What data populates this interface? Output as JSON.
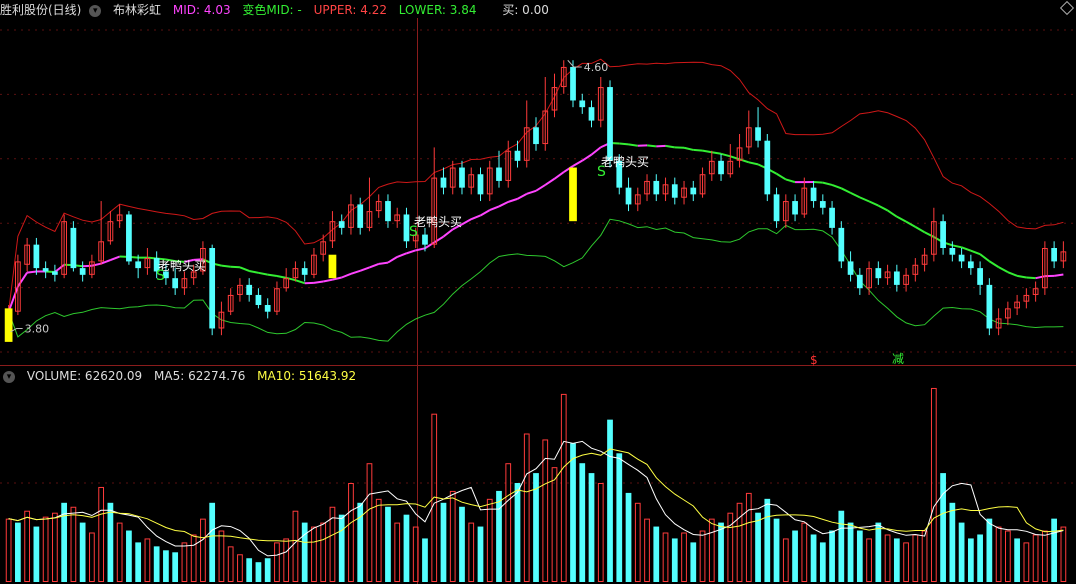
{
  "price_header": {
    "stock": "胜利股份(日线)",
    "indicator": "布林彩虹",
    "mid": "MID: 4.03",
    "color_mid": "变色MID: -",
    "upper": "UPPER: 4.22",
    "lower": "LOWER: 3.84",
    "buy": "买: 0.00"
  },
  "volume_header": {
    "volume": "VOLUME: 62620.09",
    "ma5": "MA5: 62274.76",
    "ma10": "MA10: 51643.92"
  },
  "annotations": {
    "high_label": "4.60",
    "low_label": "3.80",
    "buy_text": "老鸭头买",
    "s_mark": "S",
    "red_mark": "$",
    "reduce_mark": "减"
  },
  "colors": {
    "up": "#ff3b3b",
    "down": "#54ffff",
    "upper_band": "#d01818",
    "lower_band": "#2ec82e",
    "mid_rising": "#ff44ff",
    "mid_falling": "#33ee33",
    "signal_bar": "#ffff00",
    "vol_ma5": "#ffffff",
    "vol_ma10": "#ffff44"
  },
  "chart_data": {
    "type": "candlestick",
    "price_range": [
      3.7,
      4.72
    ],
    "candles": [
      {
        "o": 3.8,
        "c": 3.85,
        "h": 3.87,
        "l": 3.79
      },
      {
        "o": 3.85,
        "c": 4.0,
        "h": 4.02,
        "l": 3.84
      },
      {
        "o": 3.99,
        "c": 4.05,
        "h": 4.07,
        "l": 3.97
      },
      {
        "o": 4.05,
        "c": 3.98,
        "h": 4.07,
        "l": 3.96
      },
      {
        "o": 3.98,
        "c": 3.97,
        "h": 4.0,
        "l": 3.95
      },
      {
        "o": 3.97,
        "c": 3.96,
        "h": 3.99,
        "l": 3.94
      },
      {
        "o": 3.96,
        "c": 4.12,
        "h": 4.14,
        "l": 3.95
      },
      {
        "o": 4.1,
        "c": 3.98,
        "h": 4.12,
        "l": 3.97
      },
      {
        "o": 3.98,
        "c": 3.96,
        "h": 4.0,
        "l": 3.94
      },
      {
        "o": 3.96,
        "c": 4.0,
        "h": 4.02,
        "l": 3.95
      },
      {
        "o": 4.0,
        "c": 4.06,
        "h": 4.18,
        "l": 3.99
      },
      {
        "o": 4.06,
        "c": 4.12,
        "h": 4.15,
        "l": 4.05
      },
      {
        "o": 4.12,
        "c": 4.14,
        "h": 4.17,
        "l": 4.1
      },
      {
        "o": 4.14,
        "c": 4.0,
        "h": 4.15,
        "l": 3.99
      },
      {
        "o": 4.0,
        "c": 3.98,
        "h": 4.02,
        "l": 3.95
      },
      {
        "o": 3.98,
        "c": 4.01,
        "h": 4.04,
        "l": 3.96
      },
      {
        "o": 4.01,
        "c": 3.97,
        "h": 4.03,
        "l": 3.95
      },
      {
        "o": 3.97,
        "c": 3.95,
        "h": 3.99,
        "l": 3.93
      },
      {
        "o": 3.95,
        "c": 3.92,
        "h": 3.98,
        "l": 3.9
      },
      {
        "o": 3.92,
        "c": 3.95,
        "h": 3.97,
        "l": 3.9
      },
      {
        "o": 3.95,
        "c": 3.97,
        "h": 3.99,
        "l": 3.93
      },
      {
        "o": 3.97,
        "c": 4.04,
        "h": 4.06,
        "l": 3.96
      },
      {
        "o": 4.04,
        "c": 3.8,
        "h": 4.05,
        "l": 3.78
      },
      {
        "o": 3.8,
        "c": 3.85,
        "h": 3.88,
        "l": 3.78
      },
      {
        "o": 3.85,
        "c": 3.9,
        "h": 3.92,
        "l": 3.84
      },
      {
        "o": 3.9,
        "c": 3.93,
        "h": 3.95,
        "l": 3.88
      },
      {
        "o": 3.93,
        "c": 3.9,
        "h": 3.95,
        "l": 3.88
      },
      {
        "o": 3.9,
        "c": 3.87,
        "h": 3.92,
        "l": 3.86
      },
      {
        "o": 3.87,
        "c": 3.85,
        "h": 3.89,
        "l": 3.83
      },
      {
        "o": 3.85,
        "c": 3.92,
        "h": 3.94,
        "l": 3.84
      },
      {
        "o": 3.92,
        "c": 3.95,
        "h": 3.98,
        "l": 3.91
      },
      {
        "o": 3.95,
        "c": 3.98,
        "h": 4.0,
        "l": 3.94
      },
      {
        "o": 3.98,
        "c": 3.96,
        "h": 4.0,
        "l": 3.94
      },
      {
        "o": 3.96,
        "c": 4.02,
        "h": 4.04,
        "l": 3.95
      },
      {
        "o": 4.02,
        "c": 4.06,
        "h": 4.08,
        "l": 4.0
      },
      {
        "o": 4.06,
        "c": 4.12,
        "h": 4.15,
        "l": 4.04
      },
      {
        "o": 4.12,
        "c": 4.1,
        "h": 4.14,
        "l": 4.08
      },
      {
        "o": 4.1,
        "c": 4.17,
        "h": 4.2,
        "l": 4.08
      },
      {
        "o": 4.17,
        "c": 4.1,
        "h": 4.19,
        "l": 4.08
      },
      {
        "o": 4.1,
        "c": 4.15,
        "h": 4.25,
        "l": 4.09
      },
      {
        "o": 4.15,
        "c": 4.18,
        "h": 4.2,
        "l": 4.13
      },
      {
        "o": 4.18,
        "c": 4.12,
        "h": 4.2,
        "l": 4.1
      },
      {
        "o": 4.12,
        "c": 4.14,
        "h": 4.16,
        "l": 4.1
      },
      {
        "o": 4.14,
        "c": 4.06,
        "h": 4.16,
        "l": 4.04
      },
      {
        "o": 4.06,
        "c": 4.08,
        "h": 4.1,
        "l": 4.04
      },
      {
        "o": 4.08,
        "c": 4.05,
        "h": 4.1,
        "l": 4.03
      },
      {
        "o": 4.05,
        "c": 4.25,
        "h": 4.34,
        "l": 4.04
      },
      {
        "o": 4.25,
        "c": 4.22,
        "h": 4.28,
        "l": 4.2
      },
      {
        "o": 4.22,
        "c": 4.28,
        "h": 4.3,
        "l": 4.2
      },
      {
        "o": 4.28,
        "c": 4.22,
        "h": 4.3,
        "l": 4.2
      },
      {
        "o": 4.22,
        "c": 4.26,
        "h": 4.28,
        "l": 4.2
      },
      {
        "o": 4.26,
        "c": 4.2,
        "h": 4.28,
        "l": 4.18
      },
      {
        "o": 4.2,
        "c": 4.28,
        "h": 4.3,
        "l": 4.18
      },
      {
        "o": 4.28,
        "c": 4.24,
        "h": 4.33,
        "l": 4.22
      },
      {
        "o": 4.24,
        "c": 4.33,
        "h": 4.36,
        "l": 4.22
      },
      {
        "o": 4.33,
        "c": 4.3,
        "h": 4.36,
        "l": 4.28
      },
      {
        "o": 4.3,
        "c": 4.4,
        "h": 4.48,
        "l": 4.28
      },
      {
        "o": 4.4,
        "c": 4.35,
        "h": 4.43,
        "l": 4.33
      },
      {
        "o": 4.35,
        "c": 4.45,
        "h": 4.55,
        "l": 4.33
      },
      {
        "o": 4.45,
        "c": 4.52,
        "h": 4.56,
        "l": 4.43
      },
      {
        "o": 4.52,
        "c": 4.58,
        "h": 4.6,
        "l": 4.5
      },
      {
        "o": 4.58,
        "c": 4.48,
        "h": 4.6,
        "l": 4.46
      },
      {
        "o": 4.48,
        "c": 4.46,
        "h": 4.5,
        "l": 4.44
      },
      {
        "o": 4.46,
        "c": 4.42,
        "h": 4.48,
        "l": 4.4
      },
      {
        "o": 4.42,
        "c": 4.52,
        "h": 4.55,
        "l": 4.4
      },
      {
        "o": 4.52,
        "c": 4.3,
        "h": 4.54,
        "l": 4.28
      },
      {
        "o": 4.3,
        "c": 4.22,
        "h": 4.32,
        "l": 4.2
      },
      {
        "o": 4.22,
        "c": 4.17,
        "h": 4.25,
        "l": 4.15
      },
      {
        "o": 4.17,
        "c": 4.2,
        "h": 4.22,
        "l": 4.15
      },
      {
        "o": 4.2,
        "c": 4.24,
        "h": 4.26,
        "l": 4.18
      },
      {
        "o": 4.24,
        "c": 4.2,
        "h": 4.26,
        "l": 4.18
      },
      {
        "o": 4.2,
        "c": 4.23,
        "h": 4.25,
        "l": 4.18
      },
      {
        "o": 4.23,
        "c": 4.19,
        "h": 4.25,
        "l": 4.17
      },
      {
        "o": 4.19,
        "c": 4.22,
        "h": 4.24,
        "l": 4.17
      },
      {
        "o": 4.22,
        "c": 4.2,
        "h": 4.24,
        "l": 4.18
      },
      {
        "o": 4.2,
        "c": 4.26,
        "h": 4.28,
        "l": 4.19
      },
      {
        "o": 4.26,
        "c": 4.3,
        "h": 4.33,
        "l": 4.24
      },
      {
        "o": 4.3,
        "c": 4.26,
        "h": 4.32,
        "l": 4.24
      },
      {
        "o": 4.26,
        "c": 4.3,
        "h": 4.35,
        "l": 4.25
      },
      {
        "o": 4.3,
        "c": 4.34,
        "h": 4.38,
        "l": 4.28
      },
      {
        "o": 4.34,
        "c": 4.4,
        "h": 4.45,
        "l": 4.32
      },
      {
        "o": 4.4,
        "c": 4.36,
        "h": 4.46,
        "l": 4.34
      },
      {
        "o": 4.36,
        "c": 4.2,
        "h": 4.38,
        "l": 4.18
      },
      {
        "o": 4.2,
        "c": 4.12,
        "h": 4.22,
        "l": 4.1
      },
      {
        "o": 4.12,
        "c": 4.18,
        "h": 4.2,
        "l": 4.1
      },
      {
        "o": 4.18,
        "c": 4.14,
        "h": 4.2,
        "l": 4.12
      },
      {
        "o": 4.14,
        "c": 4.22,
        "h": 4.25,
        "l": 4.13
      },
      {
        "o": 4.22,
        "c": 4.18,
        "h": 4.24,
        "l": 4.16
      },
      {
        "o": 4.18,
        "c": 4.16,
        "h": 4.2,
        "l": 4.14
      },
      {
        "o": 4.16,
        "c": 4.1,
        "h": 4.18,
        "l": 4.08
      },
      {
        "o": 4.1,
        "c": 4.0,
        "h": 4.12,
        "l": 3.98
      },
      {
        "o": 4.0,
        "c": 3.96,
        "h": 4.03,
        "l": 3.94
      },
      {
        "o": 3.96,
        "c": 3.92,
        "h": 3.98,
        "l": 3.9
      },
      {
        "o": 3.92,
        "c": 3.98,
        "h": 4.0,
        "l": 3.9
      },
      {
        "o": 3.98,
        "c": 3.95,
        "h": 4.0,
        "l": 3.93
      },
      {
        "o": 3.95,
        "c": 3.97,
        "h": 3.99,
        "l": 3.93
      },
      {
        "o": 3.97,
        "c": 3.93,
        "h": 3.99,
        "l": 3.91
      },
      {
        "o": 3.93,
        "c": 3.96,
        "h": 3.98,
        "l": 3.91
      },
      {
        "o": 3.96,
        "c": 3.99,
        "h": 4.01,
        "l": 3.94
      },
      {
        "o": 3.99,
        "c": 4.02,
        "h": 4.04,
        "l": 3.97
      },
      {
        "o": 4.02,
        "c": 4.12,
        "h": 4.16,
        "l": 4.0
      },
      {
        "o": 4.12,
        "c": 4.04,
        "h": 4.14,
        "l": 4.02
      },
      {
        "o": 4.04,
        "c": 4.02,
        "h": 4.06,
        "l": 4.0
      },
      {
        "o": 4.02,
        "c": 4.0,
        "h": 4.04,
        "l": 3.98
      },
      {
        "o": 4.0,
        "c": 3.98,
        "h": 4.02,
        "l": 3.96
      },
      {
        "o": 3.98,
        "c": 3.93,
        "h": 4.0,
        "l": 3.9
      },
      {
        "o": 3.93,
        "c": 3.8,
        "h": 3.95,
        "l": 3.78
      },
      {
        "o": 3.8,
        "c": 3.83,
        "h": 3.86,
        "l": 3.78
      },
      {
        "o": 3.83,
        "c": 3.86,
        "h": 3.88,
        "l": 3.81
      },
      {
        "o": 3.86,
        "c": 3.88,
        "h": 3.9,
        "l": 3.84
      },
      {
        "o": 3.88,
        "c": 3.9,
        "h": 3.92,
        "l": 3.86
      },
      {
        "o": 3.9,
        "c": 3.92,
        "h": 3.94,
        "l": 3.88
      },
      {
        "o": 3.92,
        "c": 4.04,
        "h": 4.06,
        "l": 3.9
      },
      {
        "o": 4.04,
        "c": 4.0,
        "h": 4.06,
        "l": 3.98
      },
      {
        "o": 4.0,
        "c": 4.03,
        "h": 4.06,
        "l": 3.98
      }
    ],
    "volume_range": [
      0,
      100
    ],
    "volumes": [
      {
        "v": 32,
        "up": true
      },
      {
        "v": 30,
        "up": false
      },
      {
        "v": 36,
        "up": true
      },
      {
        "v": 28,
        "up": false
      },
      {
        "v": 33,
        "up": true
      },
      {
        "v": 35,
        "up": true
      },
      {
        "v": 40,
        "up": false
      },
      {
        "v": 38,
        "up": true
      },
      {
        "v": 30,
        "up": false
      },
      {
        "v": 25,
        "up": true
      },
      {
        "v": 48,
        "up": true
      },
      {
        "v": 40,
        "up": false
      },
      {
        "v": 30,
        "up": true
      },
      {
        "v": 26,
        "up": false
      },
      {
        "v": 20,
        "up": false
      },
      {
        "v": 22,
        "up": true
      },
      {
        "v": 18,
        "up": false
      },
      {
        "v": 16,
        "up": false
      },
      {
        "v": 15,
        "up": false
      },
      {
        "v": 20,
        "up": true
      },
      {
        "v": 24,
        "up": true
      },
      {
        "v": 32,
        "up": true
      },
      {
        "v": 40,
        "up": false
      },
      {
        "v": 26,
        "up": true
      },
      {
        "v": 18,
        "up": true
      },
      {
        "v": 14,
        "up": true
      },
      {
        "v": 12,
        "up": false
      },
      {
        "v": 10,
        "up": false
      },
      {
        "v": 12,
        "up": false
      },
      {
        "v": 20,
        "up": true
      },
      {
        "v": 22,
        "up": true
      },
      {
        "v": 36,
        "up": true
      },
      {
        "v": 30,
        "up": false
      },
      {
        "v": 28,
        "up": true
      },
      {
        "v": 30,
        "up": true
      },
      {
        "v": 38,
        "up": true
      },
      {
        "v": 34,
        "up": false
      },
      {
        "v": 50,
        "up": true
      },
      {
        "v": 40,
        "up": false
      },
      {
        "v": 60,
        "up": true
      },
      {
        "v": 42,
        "up": true
      },
      {
        "v": 38,
        "up": false
      },
      {
        "v": 30,
        "up": true
      },
      {
        "v": 34,
        "up": false
      },
      {
        "v": 28,
        "up": true
      },
      {
        "v": 22,
        "up": false
      },
      {
        "v": 85,
        "up": true
      },
      {
        "v": 40,
        "up": false
      },
      {
        "v": 46,
        "up": true
      },
      {
        "v": 38,
        "up": false
      },
      {
        "v": 30,
        "up": true
      },
      {
        "v": 28,
        "up": false
      },
      {
        "v": 42,
        "up": true
      },
      {
        "v": 46,
        "up": false
      },
      {
        "v": 60,
        "up": true
      },
      {
        "v": 50,
        "up": false
      },
      {
        "v": 75,
        "up": true
      },
      {
        "v": 55,
        "up": false
      },
      {
        "v": 72,
        "up": true
      },
      {
        "v": 58,
        "up": true
      },
      {
        "v": 95,
        "up": true
      },
      {
        "v": 70,
        "up": false
      },
      {
        "v": 60,
        "up": false
      },
      {
        "v": 55,
        "up": false
      },
      {
        "v": 50,
        "up": true
      },
      {
        "v": 82,
        "up": false
      },
      {
        "v": 65,
        "up": false
      },
      {
        "v": 45,
        "up": false
      },
      {
        "v": 40,
        "up": true
      },
      {
        "v": 32,
        "up": true
      },
      {
        "v": 28,
        "up": false
      },
      {
        "v": 25,
        "up": true
      },
      {
        "v": 22,
        "up": false
      },
      {
        "v": 25,
        "up": true
      },
      {
        "v": 20,
        "up": false
      },
      {
        "v": 26,
        "up": true
      },
      {
        "v": 32,
        "up": true
      },
      {
        "v": 30,
        "up": false
      },
      {
        "v": 35,
        "up": true
      },
      {
        "v": 40,
        "up": true
      },
      {
        "v": 45,
        "up": true
      },
      {
        "v": 35,
        "up": false
      },
      {
        "v": 42,
        "up": false
      },
      {
        "v": 32,
        "up": false
      },
      {
        "v": 22,
        "up": true
      },
      {
        "v": 26,
        "up": false
      },
      {
        "v": 30,
        "up": true
      },
      {
        "v": 24,
        "up": false
      },
      {
        "v": 20,
        "up": false
      },
      {
        "v": 26,
        "up": false
      },
      {
        "v": 36,
        "up": false
      },
      {
        "v": 30,
        "up": false
      },
      {
        "v": 26,
        "up": false
      },
      {
        "v": 22,
        "up": true
      },
      {
        "v": 30,
        "up": false
      },
      {
        "v": 24,
        "up": true
      },
      {
        "v": 22,
        "up": false
      },
      {
        "v": 20,
        "up": true
      },
      {
        "v": 24,
        "up": true
      },
      {
        "v": 26,
        "up": true
      },
      {
        "v": 98,
        "up": true
      },
      {
        "v": 55,
        "up": false
      },
      {
        "v": 40,
        "up": false
      },
      {
        "v": 30,
        "up": false
      },
      {
        "v": 22,
        "up": false
      },
      {
        "v": 24,
        "up": false
      },
      {
        "v": 32,
        "up": false
      },
      {
        "v": 28,
        "up": true
      },
      {
        "v": 26,
        "up": true
      },
      {
        "v": 22,
        "up": false
      },
      {
        "v": 20,
        "up": true
      },
      {
        "v": 24,
        "up": true
      },
      {
        "v": 26,
        "up": true
      },
      {
        "v": 32,
        "up": false
      },
      {
        "v": 28,
        "up": true
      }
    ]
  }
}
